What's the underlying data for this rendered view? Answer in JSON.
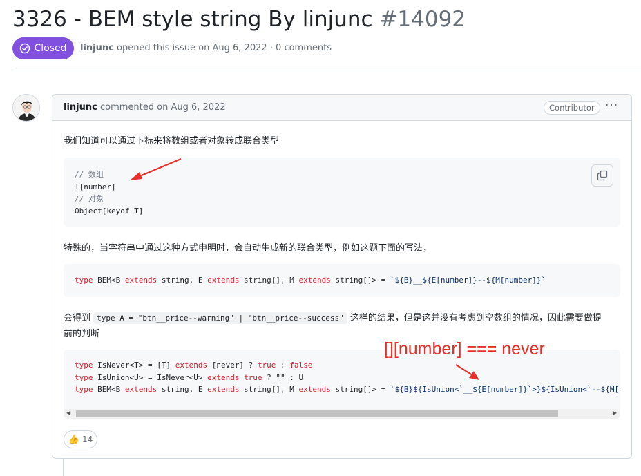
{
  "issue": {
    "title": "3326 - BEM style string By linjunc",
    "number": "#14092",
    "status": "Closed",
    "meta_author": "linjunc",
    "meta_text": "opened this issue on Aug 6, 2022 · 0 comments"
  },
  "comment": {
    "author": "linjunc",
    "action": "commented on Aug 6, 2022",
    "badge": "Contributor",
    "menu": "···",
    "para1": "我们知道可以通过下标来将数组或者对象转成联合类型",
    "code1": {
      "line1": "// 数组",
      "line2": "T[number]",
      "line3": "// 对象",
      "line4": "Object[keyof T]"
    },
    "para2": "特殊的，当字符串中通过这种方式申明时，会自动生成新的联合类型，例如这题下面的写法，",
    "code2": {
      "kw_type": "type",
      "p1": " BEM<B ",
      "kw_extends": "extends",
      "p2": " string, E ",
      "p3": " string[], M ",
      "p4": " string[]> = ",
      "str": "`${B}__${E[number]}--${M[number]}`"
    },
    "para3_before": "会得到",
    "para3_code": "type A = \"btn__price--warning\" | \"btn__price--success\"",
    "para3_after": "这样的结果，但是这并没有考虑到空数组的情况，因此需要做提",
    "para3_line2": "前的判断",
    "code3": {
      "kw_type": "type",
      "kw_extends": "extends",
      "l1a": " IsNever<T> = [T] ",
      "l1b": " [never] ? ",
      "l1c": "true",
      "l1d": " : ",
      "l1e": "false",
      "l2a": " IsUnion<U> = IsNever<U> ",
      "l2b": " ",
      "l2c": "true",
      "l2d": " ? \"\" : U",
      "l3a": " BEM<B ",
      "l3b": " string, E ",
      "l3c": " string[], M ",
      "l3d": " string[]> = ",
      "l3e": "`${B}${IsUnion<`__${E[number]}`>}${IsUnion<`--${M[nu"
    },
    "reaction_emoji": "👍",
    "reaction_count": "14"
  },
  "annotation": {
    "text": "[][number] === never",
    "color": "#e8302a"
  },
  "colors": {
    "closed": "#8250df",
    "keyword": "#cf222e",
    "string": "#0a3069"
  }
}
